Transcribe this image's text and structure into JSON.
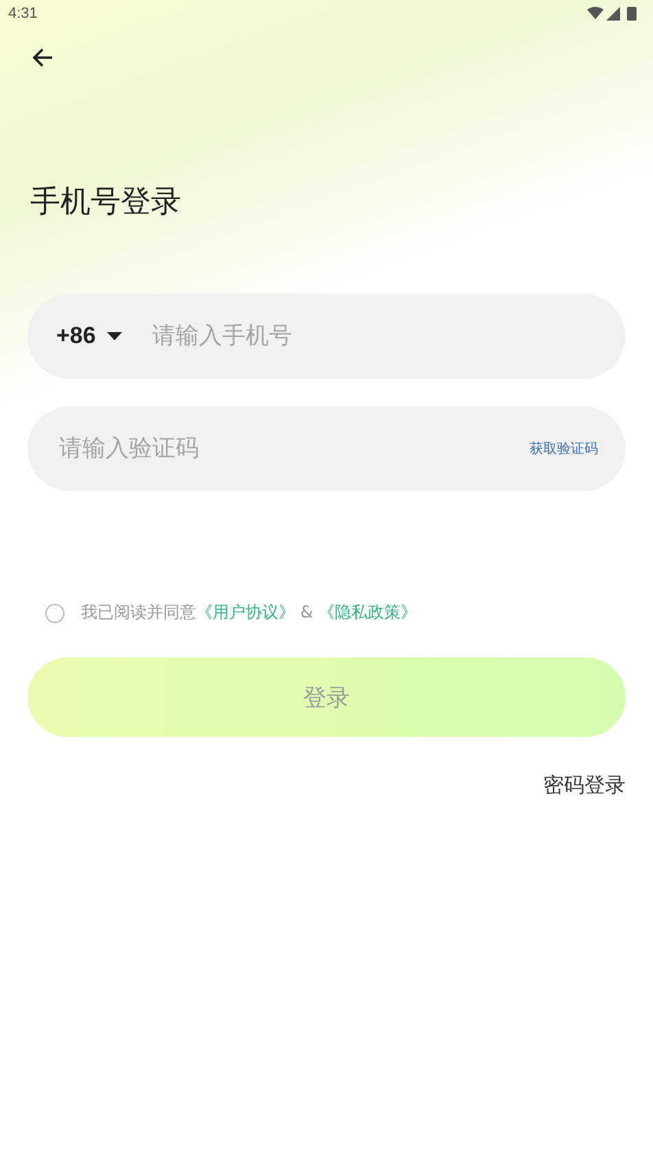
{
  "status_bar": {
    "time": "4:31"
  },
  "title": "手机号登录",
  "phone": {
    "country_code": "+86",
    "placeholder": "请输入手机号"
  },
  "code": {
    "placeholder": "请输入验证码",
    "action": "获取验证码"
  },
  "agreement": {
    "checked": false,
    "text": "我已阅读并同意",
    "link_1": "《用户协议》",
    "joiner": "&",
    "link_2": "《隐私政策》"
  },
  "login_button": {
    "label": "登录",
    "disabled": true
  },
  "alt_login": "密码登录"
}
